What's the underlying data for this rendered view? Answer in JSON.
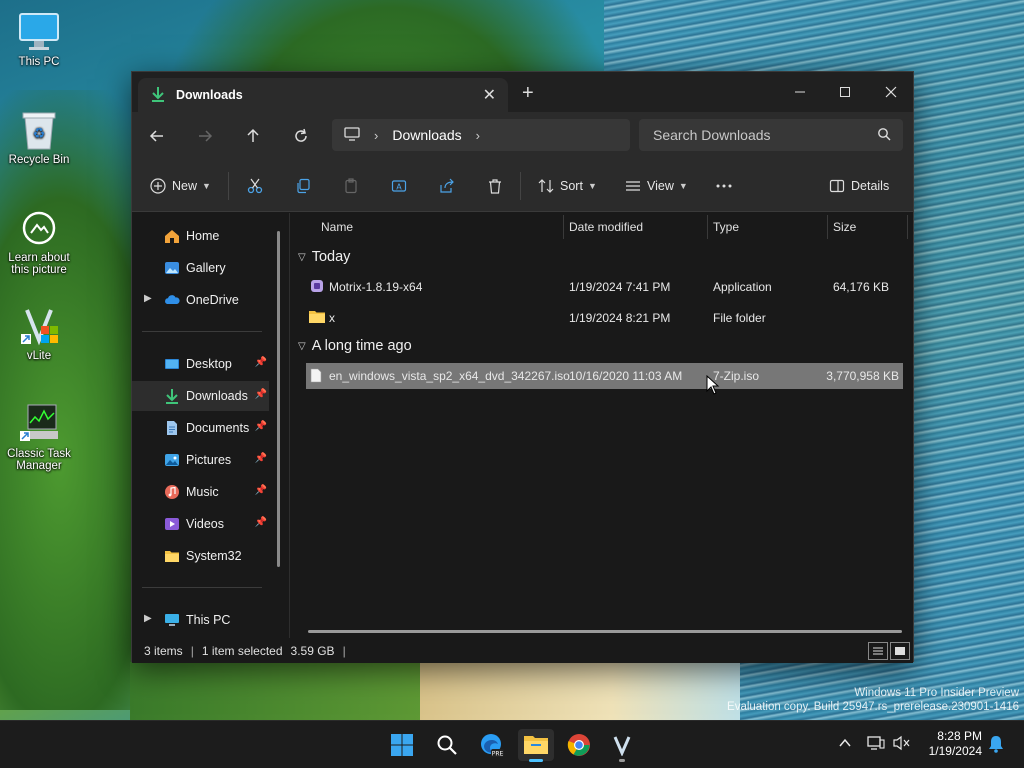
{
  "desktop": {
    "icons": [
      {
        "label": "This PC"
      },
      {
        "label": "Recycle Bin"
      },
      {
        "label": "Learn about this picture"
      },
      {
        "label": "vLite"
      },
      {
        "label": "Classic Task Manager"
      }
    ]
  },
  "window": {
    "tab_title": "Downloads",
    "nav": {
      "back": "back",
      "forward": "forward",
      "up": "up",
      "refresh": "refresh"
    },
    "address": {
      "breadcrumb": "Downloads"
    },
    "search": {
      "placeholder": "Search Downloads"
    },
    "toolbar": {
      "new_label": "New",
      "sort_label": "Sort",
      "view_label": "View",
      "details_label": "Details"
    },
    "navpane": {
      "items": [
        {
          "label": "Home"
        },
        {
          "label": "Gallery"
        },
        {
          "label": "OneDrive"
        },
        {
          "label": "Desktop"
        },
        {
          "label": "Downloads"
        },
        {
          "label": "Documents"
        },
        {
          "label": "Pictures"
        },
        {
          "label": "Music"
        },
        {
          "label": "Videos"
        },
        {
          "label": "System32"
        },
        {
          "label": "This PC"
        }
      ]
    },
    "columns": {
      "name": "Name",
      "date": "Date modified",
      "type": "Type",
      "size": "Size"
    },
    "groups": [
      {
        "title": "Today",
        "files": [
          {
            "name": "Motrix-1.8.19-x64",
            "date": "1/19/2024 7:41 PM",
            "type": "Application",
            "size": "64,176 KB"
          },
          {
            "name": "x",
            "date": "1/19/2024 8:21 PM",
            "type": "File folder",
            "size": ""
          }
        ]
      },
      {
        "title": "A long time ago",
        "files": [
          {
            "name": "en_windows_vista_sp2_x64_dvd_342267.iso",
            "date": "10/16/2020 11:03 AM",
            "type": "7-Zip.iso",
            "size": "3,770,958 KB"
          }
        ]
      }
    ],
    "status": {
      "items": "3 items",
      "selected": "1 item selected",
      "size": "3.59 GB"
    }
  },
  "watermark": {
    "line1": "Windows 11 Pro Insider Preview",
    "line2": "Evaluation copy. Build 25947.rs_prerelease.230901-1416"
  },
  "taskbar": {
    "time": "8:28 PM",
    "date": "1/19/2024"
  },
  "colors": {
    "accent": "#4cc2ff",
    "window_bg": "#191919",
    "toolbar_bg": "#2b2b2b",
    "selection": "#777777"
  }
}
